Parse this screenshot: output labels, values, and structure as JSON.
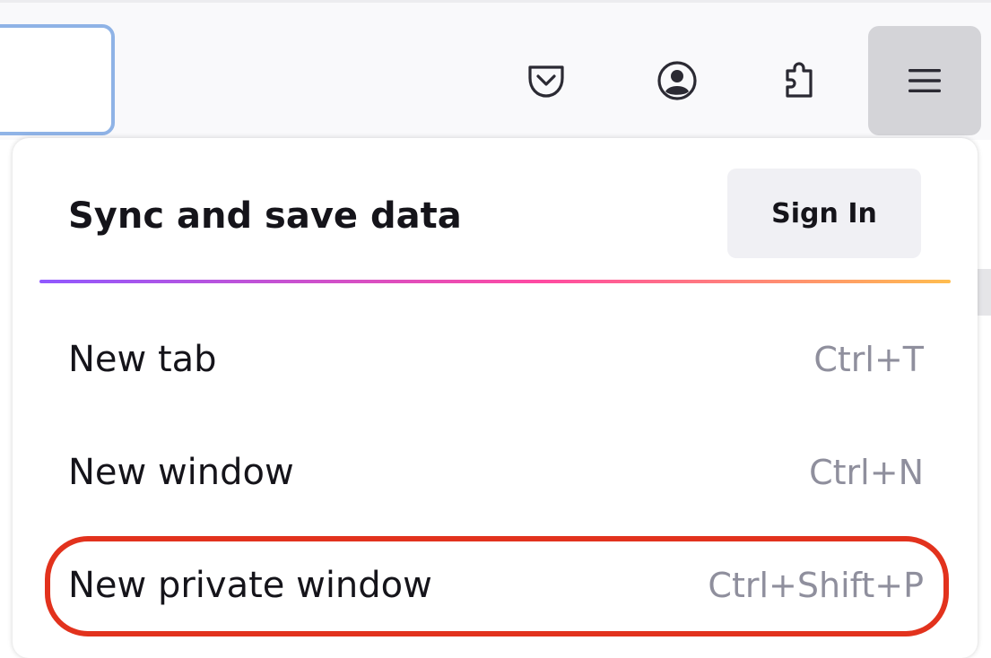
{
  "toolbar": {
    "icons": [
      "pocket-icon",
      "account-icon",
      "extensions-icon",
      "hamburger-menu-icon"
    ]
  },
  "menu": {
    "sync_title": "Sync and save data",
    "sign_in_label": "Sign In",
    "items": [
      {
        "label": "New tab",
        "shortcut": "Ctrl+T"
      },
      {
        "label": "New window",
        "shortcut": "Ctrl+N"
      },
      {
        "label": "New private window",
        "shortcut": "Ctrl+Shift+P"
      }
    ]
  },
  "colors": {
    "highlight_ring": "#e2321d",
    "separator_gradient": [
      "#9059ff",
      "#ff4aa2",
      "#ffbd4f"
    ],
    "menu_button_active": "#d4d4d8"
  }
}
